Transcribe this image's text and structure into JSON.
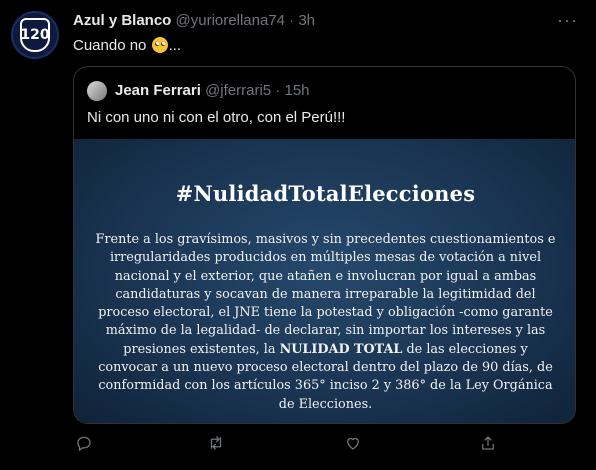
{
  "tweet": {
    "display_name": "Azul y Blanco",
    "handle": "@yuriorellana74",
    "time": "3h",
    "text_before": "Cuando no",
    "text_after": "...",
    "avatar_text": "120",
    "more_label": "···"
  },
  "quote": {
    "display_name": "Jean Ferrari",
    "handle": "@jferrari5",
    "time": "15h",
    "text": "Ni con uno ni con el otro, con el Perú!!!",
    "image": {
      "title": "#NulidadTotalElecciones",
      "body_before": "Frente a los gravísimos, masivos y sin precedentes cuestionamientos e irregularidades producidos en múltiples mesas de votación a nivel nacional y el exterior, que atañen e involucran por igual a ambas candidaturas y socavan de manera irreparable la legitimidad del proceso electoral, el JNE tiene la potestad y obligación -como garante máximo de la legalidad- de declarar, sin importar los intereses y las presiones existentes, la ",
      "body_bold": "NULIDAD TOTAL",
      "body_after": " de las elecciones y convocar a un nuevo proceso electoral dentro del plazo de 90 días, de conformidad con los artículos 365° inciso 2 y 386° de la Ley Orgánica de Elecciones."
    }
  },
  "actions": [
    "reply-icon",
    "retweet-icon",
    "like-icon",
    "share-icon"
  ],
  "colors": {
    "background": "#000000",
    "text": "#e7e9ea",
    "muted": "#71767b",
    "border": "#2f3336",
    "image_bg": "#1f3d5c"
  }
}
